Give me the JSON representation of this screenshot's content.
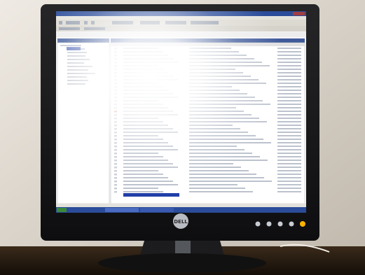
{
  "photo": {
    "subject": "monitor-displaying-email-client",
    "monitor_brand": "DELL"
  },
  "colors": {
    "wall": "#d8d2c8",
    "desk": "#2a1f14",
    "bezel": "#1a1a1c",
    "screen_glare": "#ffffff",
    "titlebar": "#2b4c9a",
    "selection": "#1f3fa8",
    "power_led": "#ffb400"
  }
}
